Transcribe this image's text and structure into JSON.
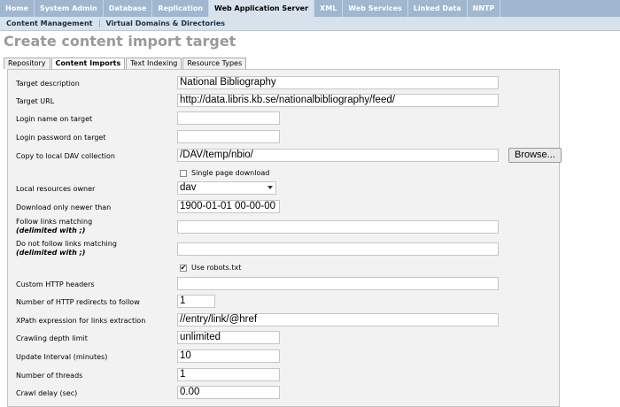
{
  "topnav": {
    "tabs": [
      {
        "label": "Home"
      },
      {
        "label": "System Admin"
      },
      {
        "label": "Database"
      },
      {
        "label": "Replication"
      },
      {
        "label": "Web Application Server",
        "active": true
      },
      {
        "label": "XML"
      },
      {
        "label": "Web Services"
      },
      {
        "label": "Linked Data"
      },
      {
        "label": "NNTP"
      }
    ]
  },
  "subnav": {
    "items": [
      {
        "label": "Content Management"
      },
      {
        "label": "Virtual Domains & Directories"
      }
    ]
  },
  "page": {
    "title": "Create content import target"
  },
  "tabs": [
    {
      "label": "Repository"
    },
    {
      "label": "Content Imports",
      "active": true
    },
    {
      "label": "Text Indexing"
    },
    {
      "label": "Resource Types"
    }
  ],
  "form": {
    "target_description": {
      "label": "Target description",
      "value": "National Bibliography"
    },
    "target_url": {
      "label": "Target URL",
      "value": "http://data.libris.kb.se/nationalbibliography/feed/"
    },
    "login_name": {
      "label": "Login name on target",
      "value": ""
    },
    "login_password": {
      "label": "Login password on target",
      "value": ""
    },
    "dav_collection": {
      "label": "Copy to local DAV collection",
      "value": "/DAV/temp/nbio/",
      "browse_label": "Browse..."
    },
    "single_page": {
      "label": "Single page download",
      "checked": false
    },
    "resources_owner": {
      "label": "Local resources owner",
      "value": "dav"
    },
    "newer_than": {
      "label": "Download only newer than",
      "value": "1900-01-01 00-00-00"
    },
    "follow_links": {
      "label": "Follow links matching",
      "sublabel": "(delimited with ;)",
      "value": ""
    },
    "no_follow_links": {
      "label": "Do not follow links matching",
      "sublabel": "(delimited with ;)",
      "value": ""
    },
    "robots": {
      "label": "Use robots.txt",
      "checked": true,
      "mark": "✔"
    },
    "http_headers": {
      "label": "Custom HTTP headers",
      "value": ""
    },
    "redirects": {
      "label": "Number of HTTP redirects to follow",
      "value": "1"
    },
    "xpath": {
      "label": "XPath expression for links extraction",
      "value": "//entry/link/@href"
    },
    "depth": {
      "label": "Crawling depth limit",
      "value": "unlimited"
    },
    "update_interval": {
      "label": "Update Interval (minutes)",
      "value": "10"
    },
    "threads": {
      "label": "Number of threads",
      "value": "1"
    },
    "crawl_delay": {
      "label": "Crawl delay (sec)",
      "value": "0.00"
    }
  }
}
